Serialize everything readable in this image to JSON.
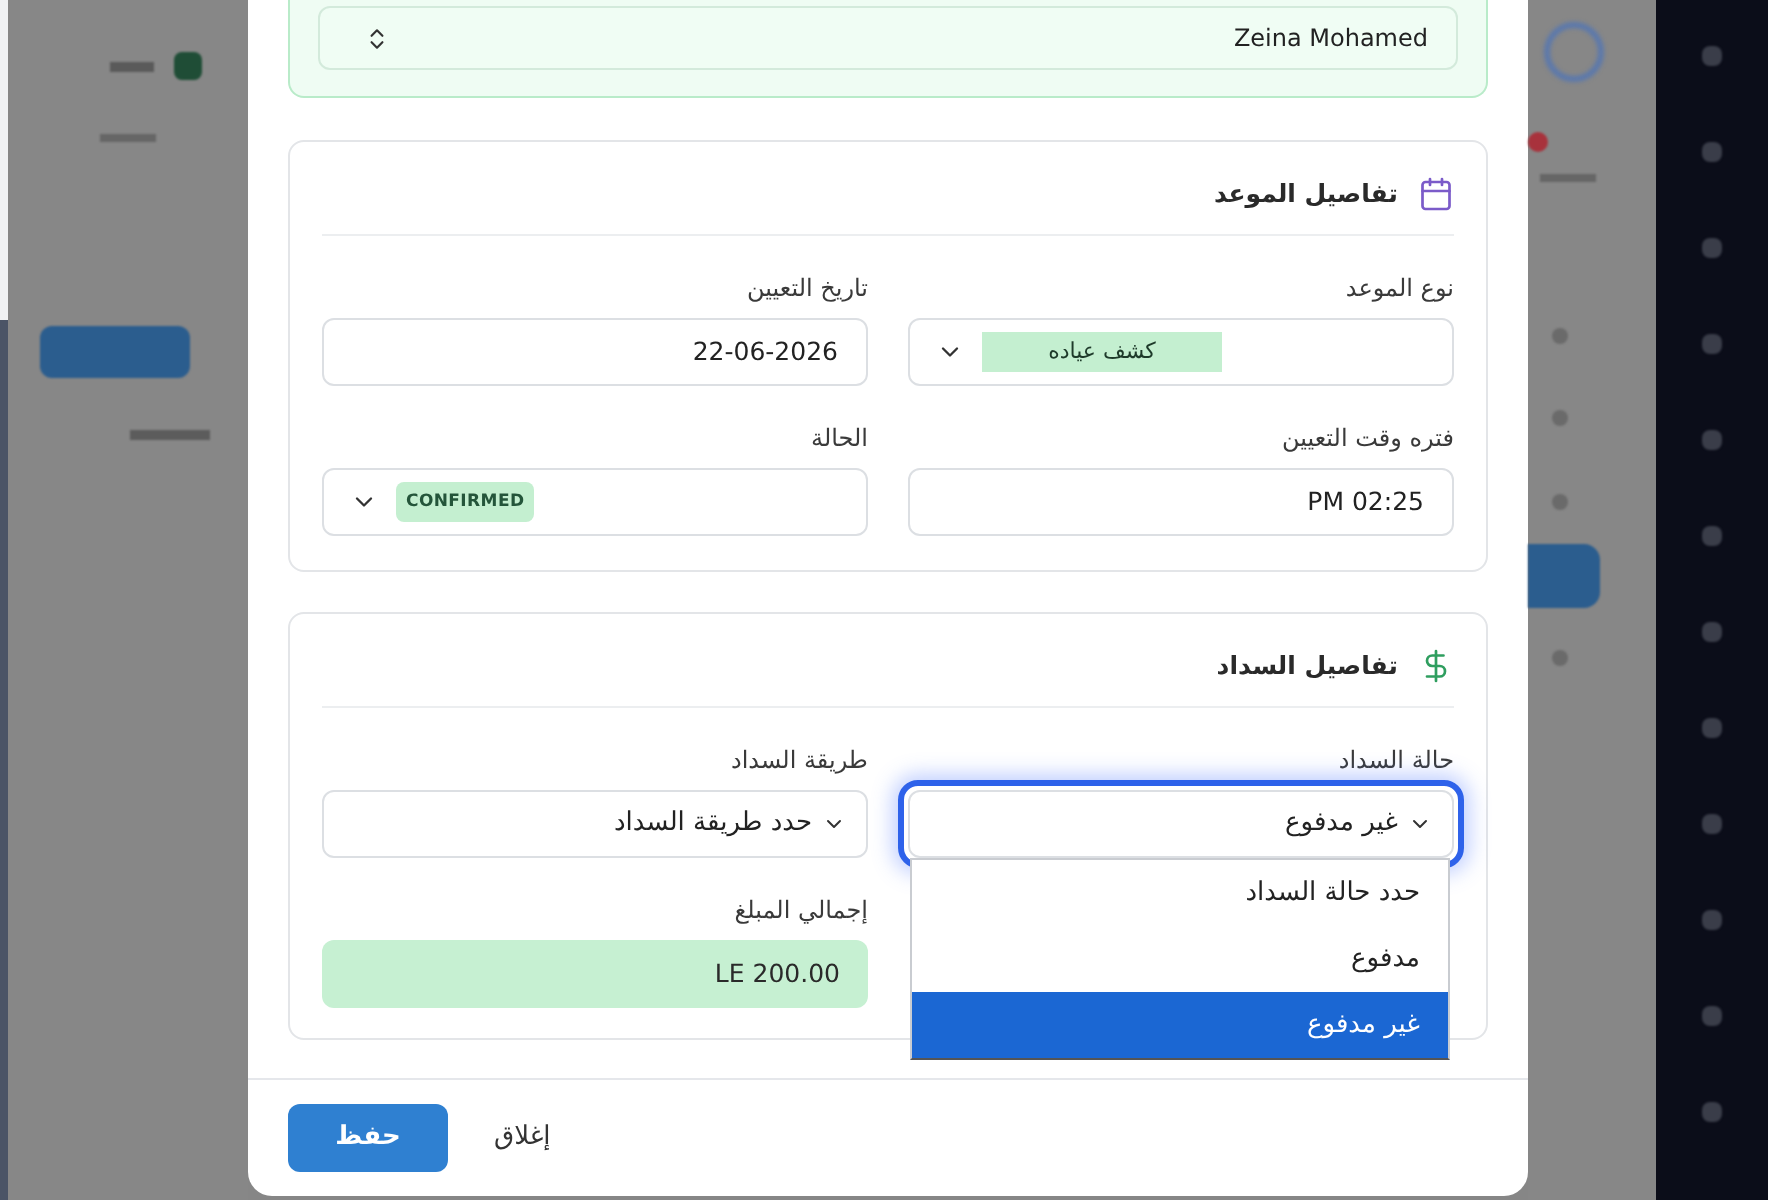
{
  "patient": {
    "value": "Zeina Mohamed"
  },
  "appointment_details": {
    "title": "تفاصيل الموعد",
    "fields": [
      {
        "kind": "tag_select",
        "label": "نوع الموعد",
        "value": "كشف عياده"
      },
      {
        "kind": "text",
        "label": "تاريخ التعيين",
        "value": "22-06-2026"
      },
      {
        "kind": "text",
        "label": "فتره وقت التعيين",
        "value": "PM 02:25"
      },
      {
        "kind": "status_select",
        "label": "الحالة",
        "value": "CONFIRMED"
      }
    ]
  },
  "payment_details": {
    "title": "تفاصيل السداد",
    "fields": [
      {
        "kind": "select",
        "label": "حالة السداد",
        "value": "غير مدفوع",
        "expanded": true,
        "options": [
          {
            "label": "حدد حالة السداد",
            "selected": false
          },
          {
            "label": "مدفوع",
            "selected": false
          },
          {
            "label": "غير مدفوع",
            "selected": true
          }
        ]
      },
      {
        "kind": "select",
        "label": "طريقة السداد",
        "value": "حدد طريقة السداد",
        "expanded": false
      },
      {
        "kind": "amount",
        "label": "إجمالي المبلغ",
        "value": "LE 200.00"
      }
    ]
  },
  "footer": {
    "buttons": [
      {
        "kind": "plain",
        "label": "إغلاق"
      },
      {
        "kind": "primary",
        "label": "حفظ"
      }
    ]
  }
}
